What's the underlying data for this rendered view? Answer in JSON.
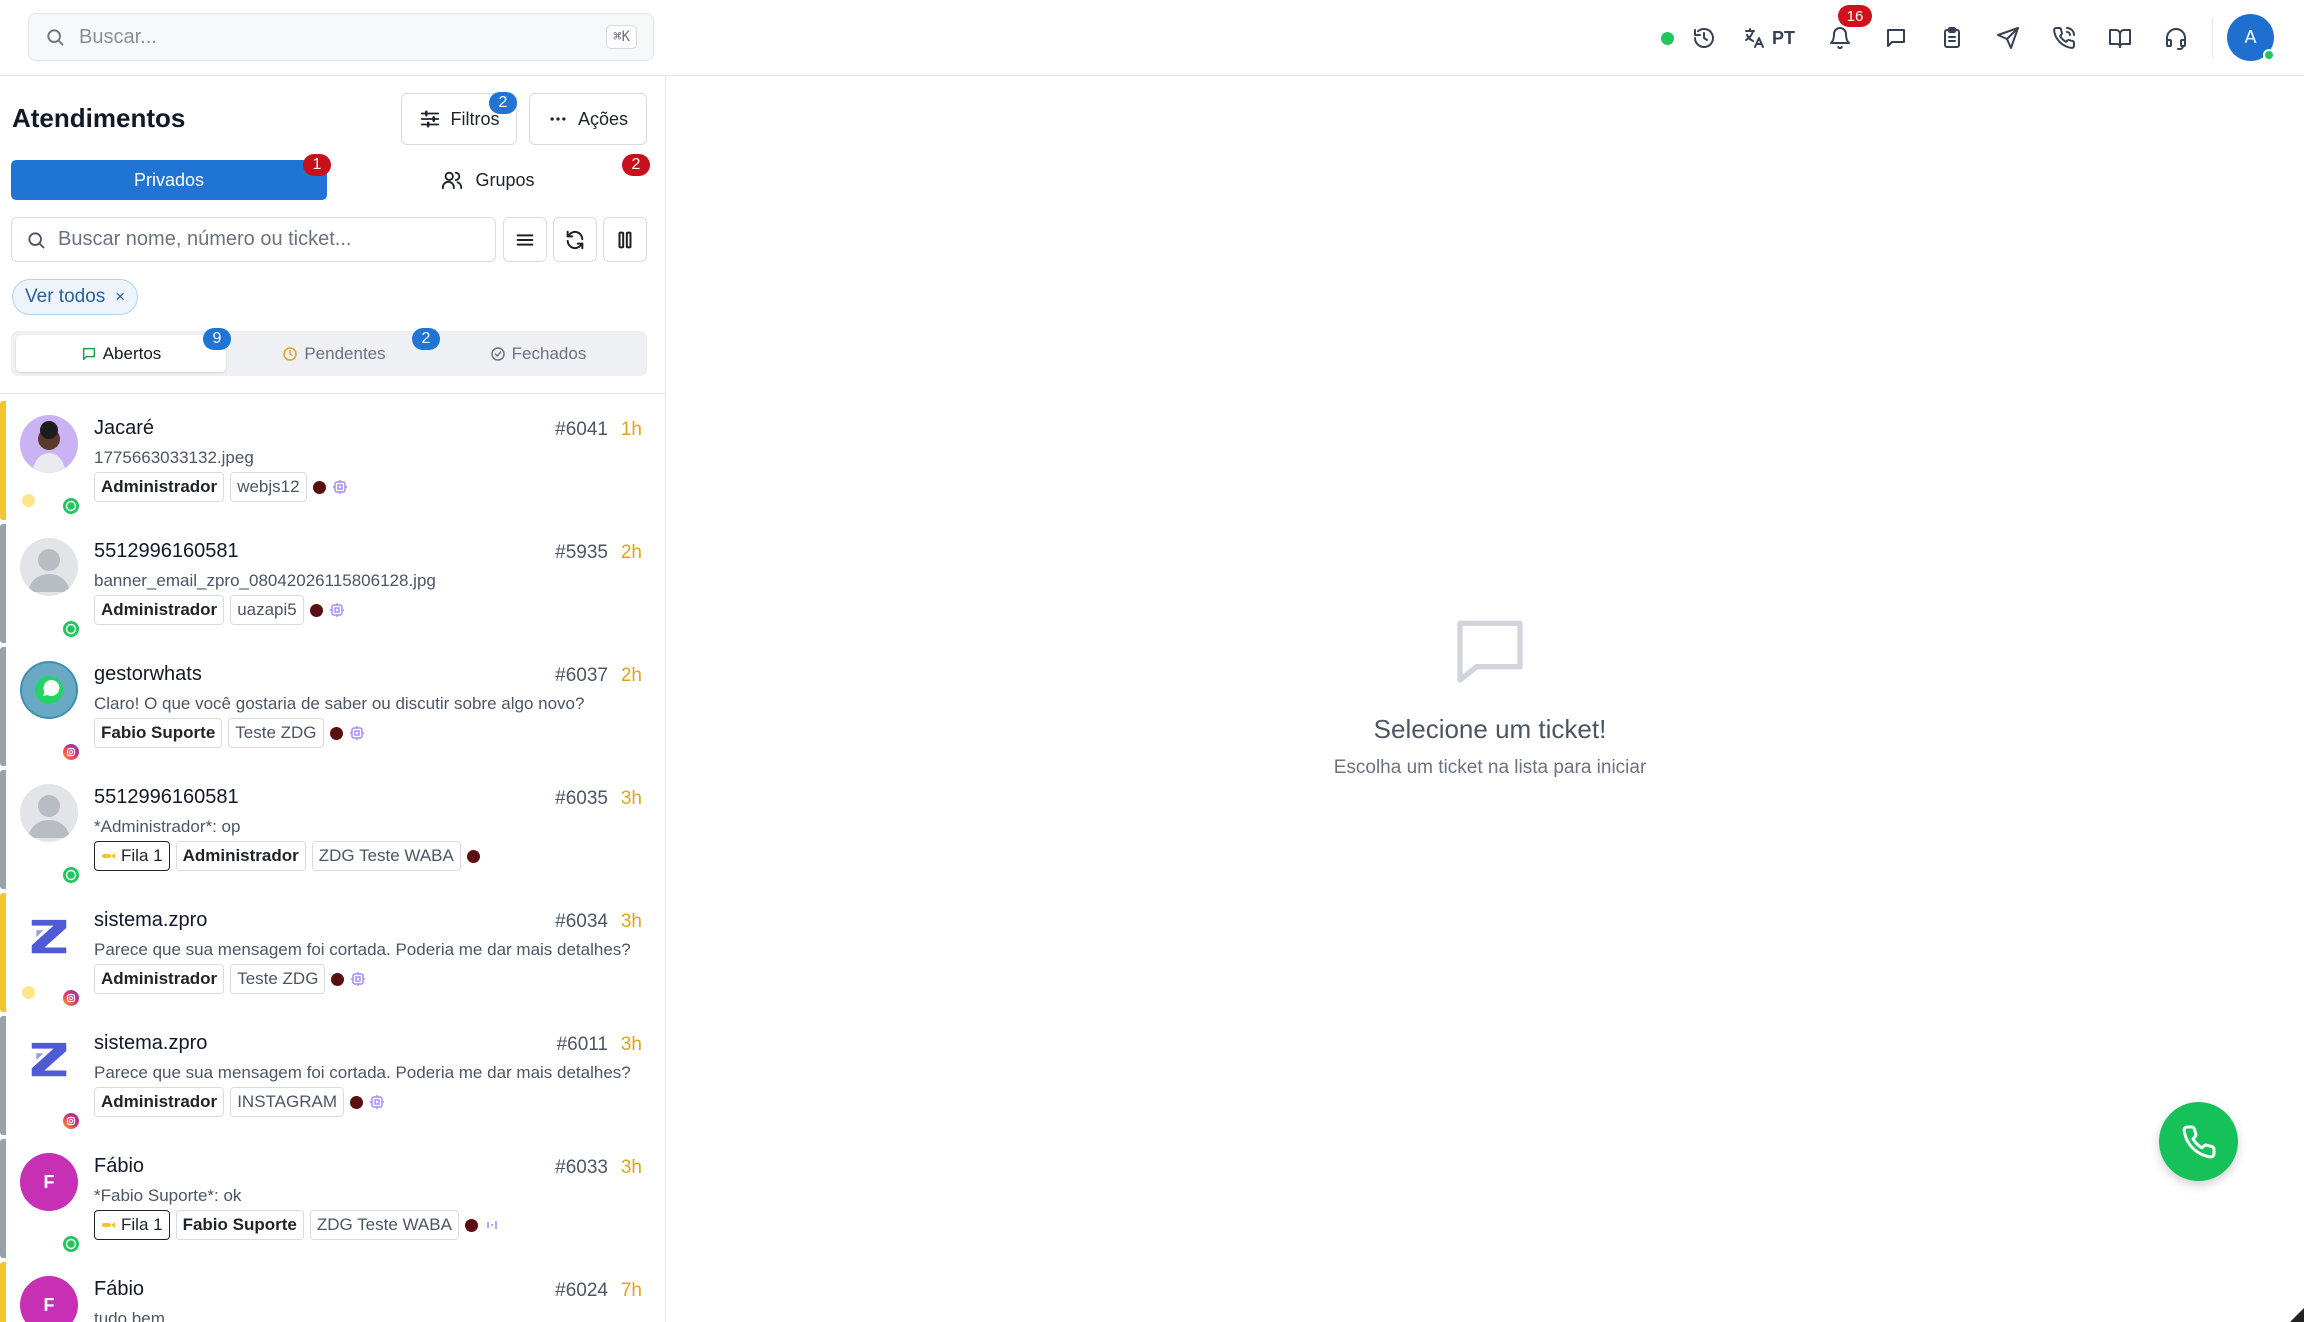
{
  "header": {
    "search_placeholder": "Buscar...",
    "search_shortcut": "⌘K",
    "language": "PT",
    "notifications_count": "16",
    "user_initial": "A",
    "icons": [
      "status-online",
      "history-icon",
      "translate-icon",
      "bell-icon",
      "chat-icon",
      "clipboard-icon",
      "send-icon",
      "phone-call-icon",
      "book-icon",
      "headset-icon"
    ]
  },
  "panel": {
    "title": "Atendimentos",
    "filters_label": "Filtros",
    "filters_count": "2",
    "actions_label": "Ações",
    "tab_private": "Privados",
    "tab_private_count": "1",
    "tab_groups": "Grupos",
    "tab_groups_count": "2",
    "search_placeholder": "Buscar nome, número ou ticket...",
    "chip_label": "Ver todos",
    "chip_close": "×",
    "seg_open": "Abertos",
    "seg_open_count": "9",
    "seg_pending": "Pendentes",
    "seg_pending_count": "2",
    "seg_closed": "Fechados"
  },
  "tickets": [
    {
      "name": "Jacaré",
      "number": "#6041",
      "time": "1h",
      "message": "1775663033132.jpeg",
      "tags": [
        "Administrador",
        "webjs12"
      ],
      "fila": "",
      "channel": "whatsapp",
      "bar": "#f4c430",
      "pending": true
    },
    {
      "name": "5512996160581",
      "number": "#5935",
      "time": "2h",
      "message": "banner_email_zpro_08042026115806128.jpg",
      "tags": [
        "Administrador",
        "uazapi5"
      ],
      "fila": "",
      "channel": "whatsapp",
      "bar": "#9aa1ab",
      "pending": false
    },
    {
      "name": "gestorwhats",
      "number": "#6037",
      "time": "2h",
      "message": "Claro! O que você gostaria de saber ou discutir sobre algo novo?",
      "tags": [
        "Fabio Suporte",
        "Teste ZDG"
      ],
      "fila": "",
      "channel": "instagram",
      "bar": "#9aa1ab",
      "pending": false
    },
    {
      "name": "5512996160581",
      "number": "#6035",
      "time": "3h",
      "message": "*Administrador*: op",
      "tags": [
        "Administrador",
        "ZDG Teste WABA"
      ],
      "fila": "Fila 1",
      "channel": "whatsapp",
      "bar": "#9aa1ab",
      "pending": false
    },
    {
      "name": "sistema.zpro",
      "number": "#6034",
      "time": "3h",
      "message": "Parece que sua mensagem foi cortada. Poderia me dar mais detalhes?",
      "tags": [
        "Administrador",
        "Teste ZDG"
      ],
      "fila": "",
      "channel": "instagram",
      "bar": "#f4c430",
      "pending": true
    },
    {
      "name": "sistema.zpro",
      "number": "#6011",
      "time": "3h",
      "message": "Parece que sua mensagem foi cortada. Poderia me dar mais detalhes?",
      "tags": [
        "Administrador",
        "INSTAGRAM"
      ],
      "fila": "",
      "channel": "instagram",
      "bar": "#9aa1ab",
      "pending": false
    },
    {
      "name": "Fábio",
      "number": "#6033",
      "time": "3h",
      "message": "*Fabio Suporte*: ok",
      "tags": [
        "Fabio Suporte",
        "ZDG Teste WABA"
      ],
      "fila": "Fila 1",
      "channel": "whatsapp",
      "bar": "#9aa1ab",
      "pending": false
    },
    {
      "name": "Fábio",
      "number": "#6024",
      "time": "7h",
      "message": "tudo bem",
      "tags": [],
      "fila": "",
      "channel": "whatsapp",
      "bar": "#f4c430",
      "pending": false
    }
  ],
  "empty_state": {
    "title": "Selecione um ticket!",
    "subtitle": "Escolha um ticket na lista para iniciar"
  }
}
